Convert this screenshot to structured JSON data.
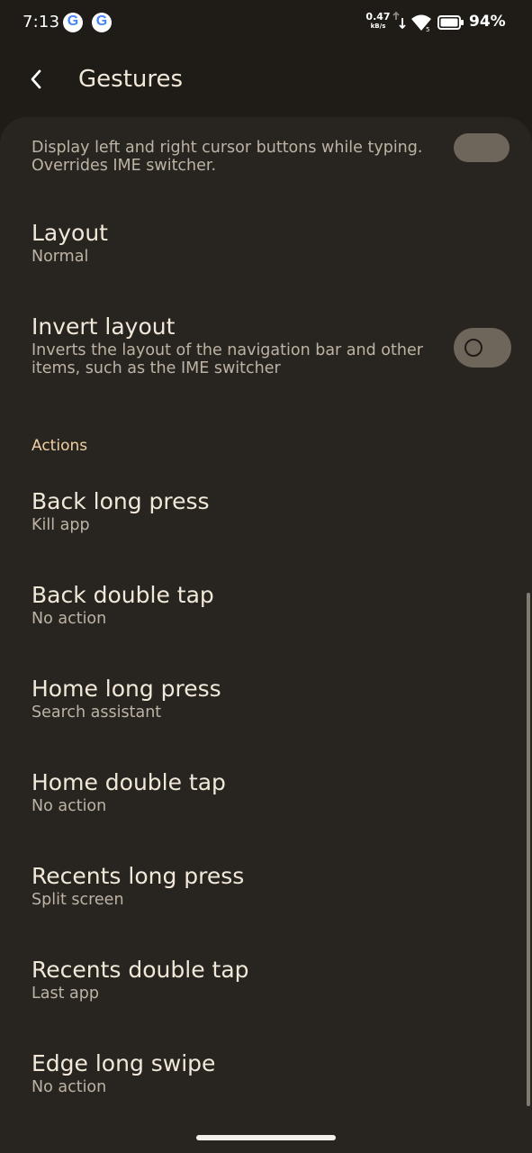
{
  "status_bar": {
    "time": "7:13",
    "notification_icons": [
      "google-g-icon",
      "google-g-icon"
    ],
    "net_speed_value": "0.47",
    "net_speed_unit": "kB/s",
    "battery_percent": "94%",
    "icons": [
      "data-arrows-icon",
      "wifi-icon",
      "battery-icon"
    ]
  },
  "app_bar": {
    "back_icon": "chevron-left-icon",
    "title": "Gestures"
  },
  "cut_off_item": {
    "description": "Display left and right cursor buttons while typing. Overrides IME switcher.",
    "toggle_on": true
  },
  "items_top": [
    {
      "title": "Layout",
      "subtitle": "Normal"
    },
    {
      "title": "Invert layout",
      "subtitle": "Inverts the layout of the navigation bar and other items, such as the IME switcher",
      "toggle_on": false
    }
  ],
  "actions_section": {
    "header": "Actions",
    "items": [
      {
        "title": "Back long press",
        "subtitle": "Kill app"
      },
      {
        "title": "Back double tap",
        "subtitle": "No action"
      },
      {
        "title": "Home long press",
        "subtitle": "Search assistant"
      },
      {
        "title": "Home double tap",
        "subtitle": "No action"
      },
      {
        "title": "Recents long press",
        "subtitle": "Split screen"
      },
      {
        "title": "Recents double tap",
        "subtitle": "Last app"
      },
      {
        "title": "Edge long swipe",
        "subtitle": "No action"
      }
    ]
  },
  "colors": {
    "background": "#1f1c18",
    "surface": "#282520",
    "accent": "#f0cfa4",
    "toggle_track": "#6e655b"
  }
}
